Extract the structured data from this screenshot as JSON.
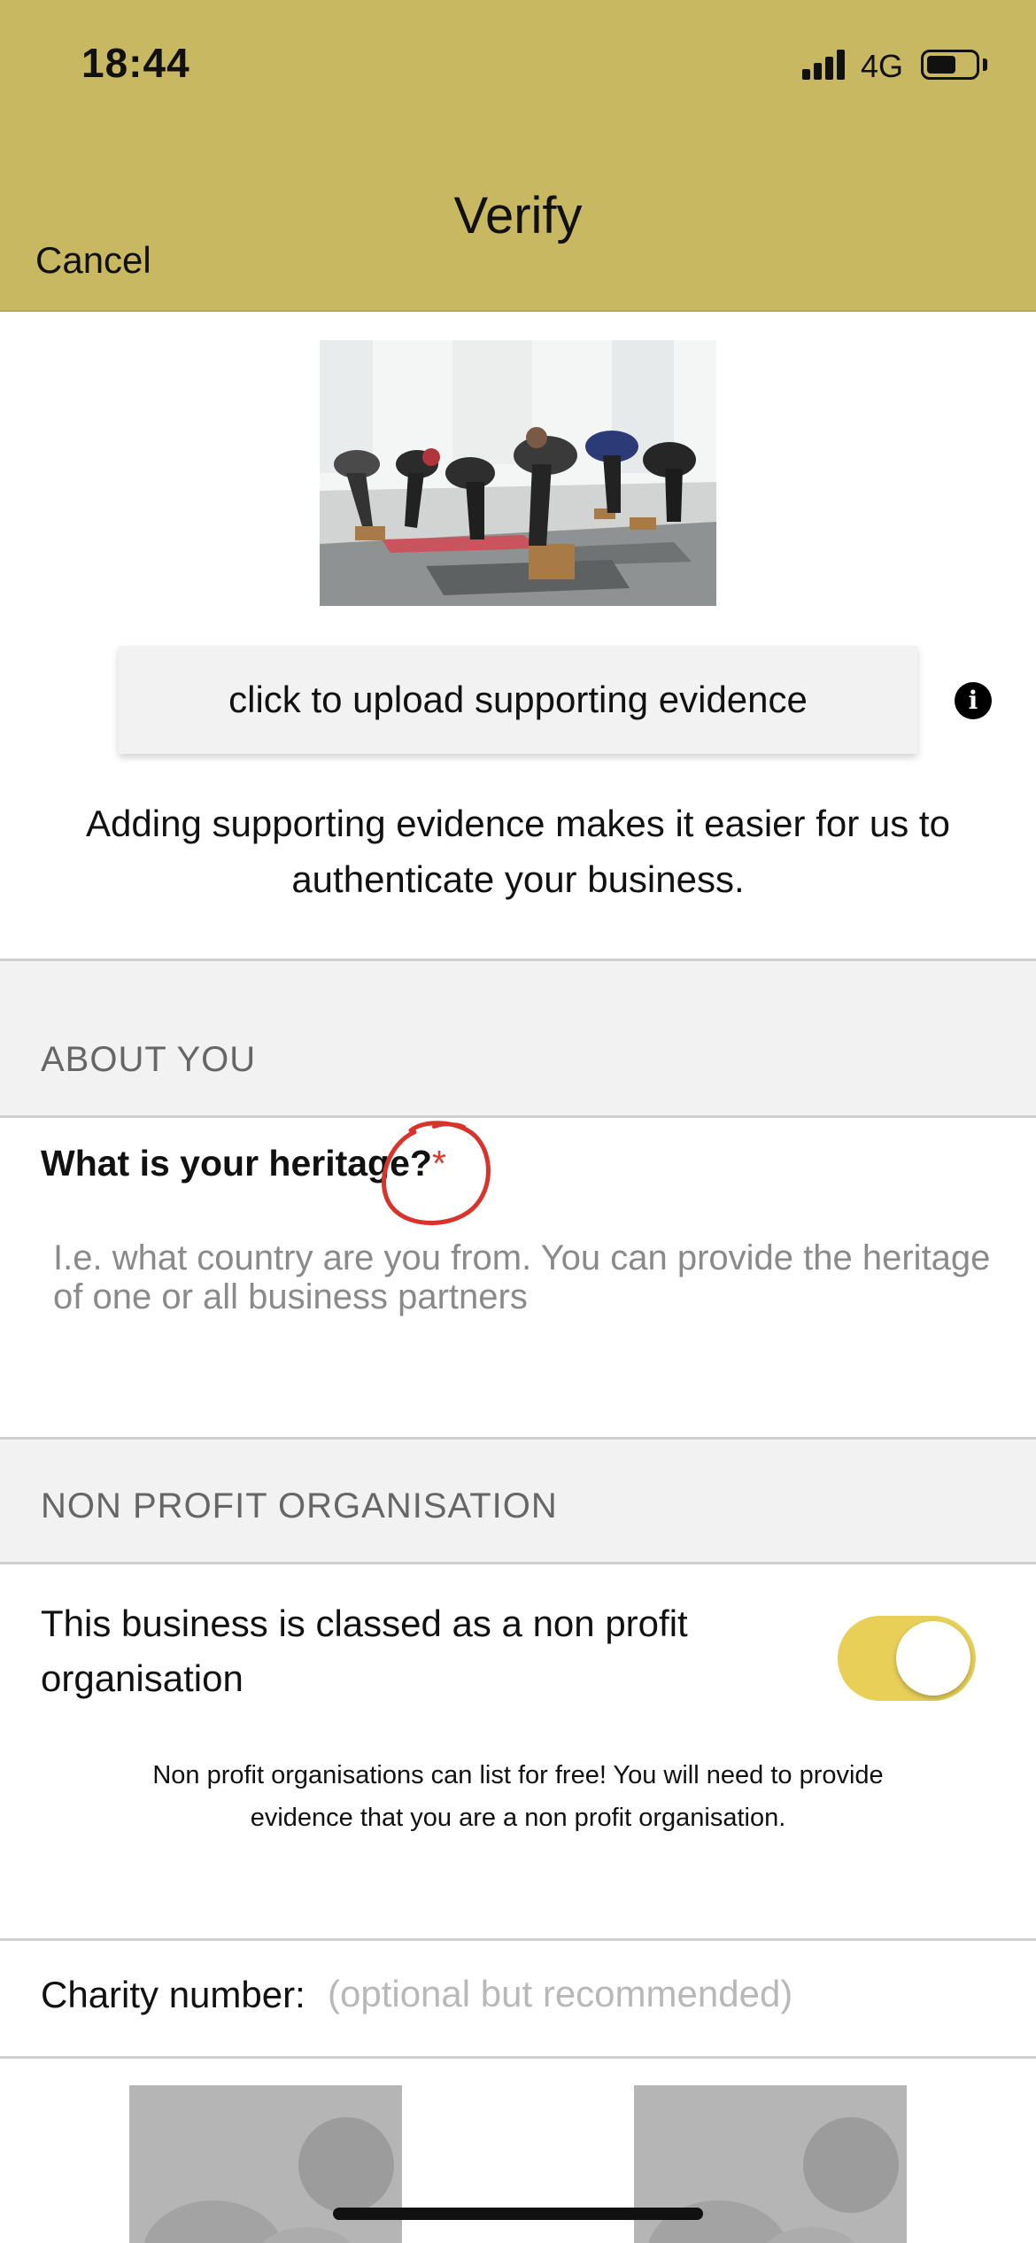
{
  "status_bar": {
    "time": "18:44",
    "network": "4G",
    "battery_level": 0.6
  },
  "nav": {
    "title": "Verify",
    "cancel_label": "Cancel"
  },
  "colors": {
    "header": "#c9b862",
    "toggle_on": "#e8cf58",
    "required": "#d93a2b",
    "annotation": "#d9342b"
  },
  "upload": {
    "button_label": "click to upload supporting evidence",
    "info_icon": "info-icon"
  },
  "evidence_text": "Adding supporting evidence makes it easier for us to authenticate your business.",
  "about_you": {
    "section_title": "ABOUT YOU",
    "heritage_label": "What is your heritage?",
    "required_mark": "*",
    "heritage_placeholder": "I.e. what country are you from. You can provide the heritage of one or all business partners"
  },
  "non_profit": {
    "section_title": "NON PROFIT ORGANISATION",
    "toggle_label": "This business is classed as a non profit organisation",
    "toggle_on": true,
    "note": "Non profit organisations can list for free! You will need to provide evidence that you are a non profit organisation."
  },
  "charity": {
    "label": "Charity number:",
    "placeholder": "(optional but recommended)"
  }
}
